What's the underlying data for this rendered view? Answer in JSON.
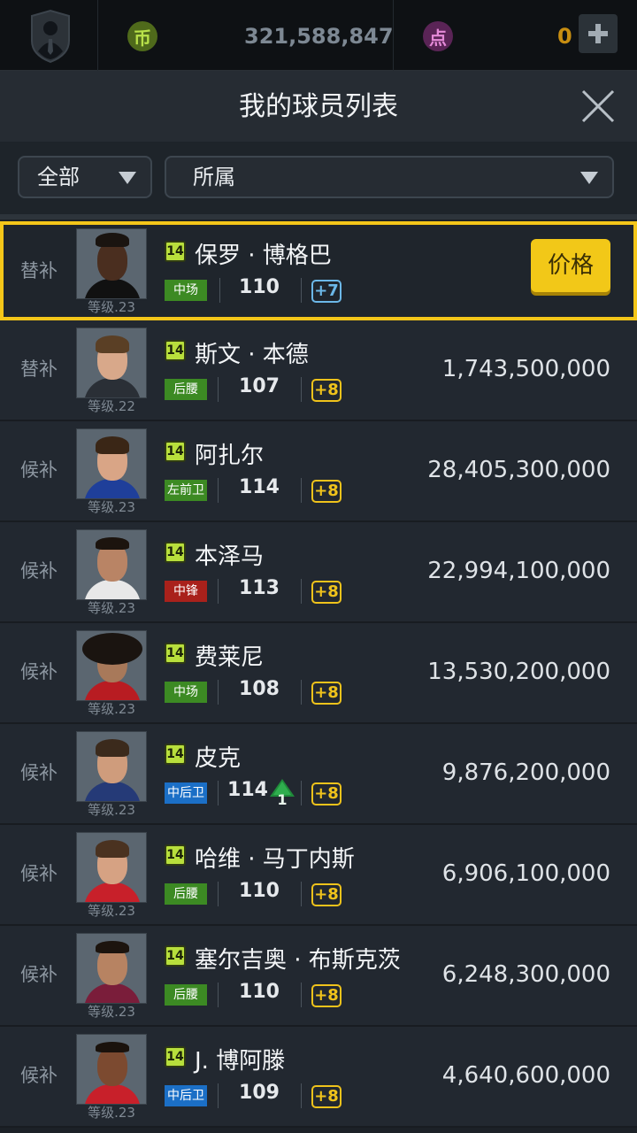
{
  "topbar": {
    "coins_icon_char": "币",
    "coins_value": "321,588,847",
    "points_icon_char": "点",
    "points_value": "0"
  },
  "header": {
    "title": "我的球员列表"
  },
  "filters": {
    "category": "全部",
    "affiliation": "所属"
  },
  "players": [
    {
      "status": "替补",
      "season": "14",
      "name": "保罗 · 博格巴",
      "position": "中场",
      "rating": "110",
      "boost": "+7",
      "level": "等级.23",
      "price_button": "价格"
    },
    {
      "status": "替补",
      "season": "14",
      "name": "斯文 · 本德",
      "position": "后腰",
      "rating": "107",
      "boost": "+8",
      "level": "等级.22",
      "price": "1,743,500,000"
    },
    {
      "status": "候补",
      "season": "14",
      "name": "阿扎尔",
      "position": "左前卫",
      "rating": "114",
      "boost": "+8",
      "level": "等级.23",
      "price": "28,405,300,000"
    },
    {
      "status": "候补",
      "season": "14",
      "name": "本泽马",
      "position": "中锋",
      "rating": "113",
      "boost": "+8",
      "level": "等级.23",
      "price": "22,994,100,000"
    },
    {
      "status": "候补",
      "season": "14",
      "name": "费莱尼",
      "position": "中场",
      "rating": "108",
      "boost": "+8",
      "level": "等级.23",
      "price": "13,530,200,000"
    },
    {
      "status": "候补",
      "season": "14",
      "name": "皮克",
      "position": "中后卫",
      "rating": "114",
      "rating_change": "1",
      "boost": "+8",
      "level": "等级.23",
      "price": "9,876,200,000"
    },
    {
      "status": "候补",
      "season": "14",
      "name": "哈维 · 马丁内斯",
      "position": "后腰",
      "rating": "110",
      "boost": "+8",
      "level": "等级.23",
      "price": "6,906,100,000"
    },
    {
      "status": "候补",
      "season": "14",
      "name": "塞尔吉奥 · 布斯克茨",
      "position": "后腰",
      "rating": "110",
      "boost": "+8",
      "level": "等级.23",
      "price": "6,248,300,000"
    },
    {
      "status": "候补",
      "season": "14",
      "name": "J. 博阿滕",
      "position": "中后卫",
      "rating": "109",
      "boost": "+8",
      "level": "等级.23",
      "price": "4,640,600,000"
    }
  ],
  "colors": {
    "accent_yellow": "#f4c619",
    "midfield_green": "#3c8a23",
    "forward_red": "#a9211b",
    "defender_blue": "#1b6fc6"
  }
}
